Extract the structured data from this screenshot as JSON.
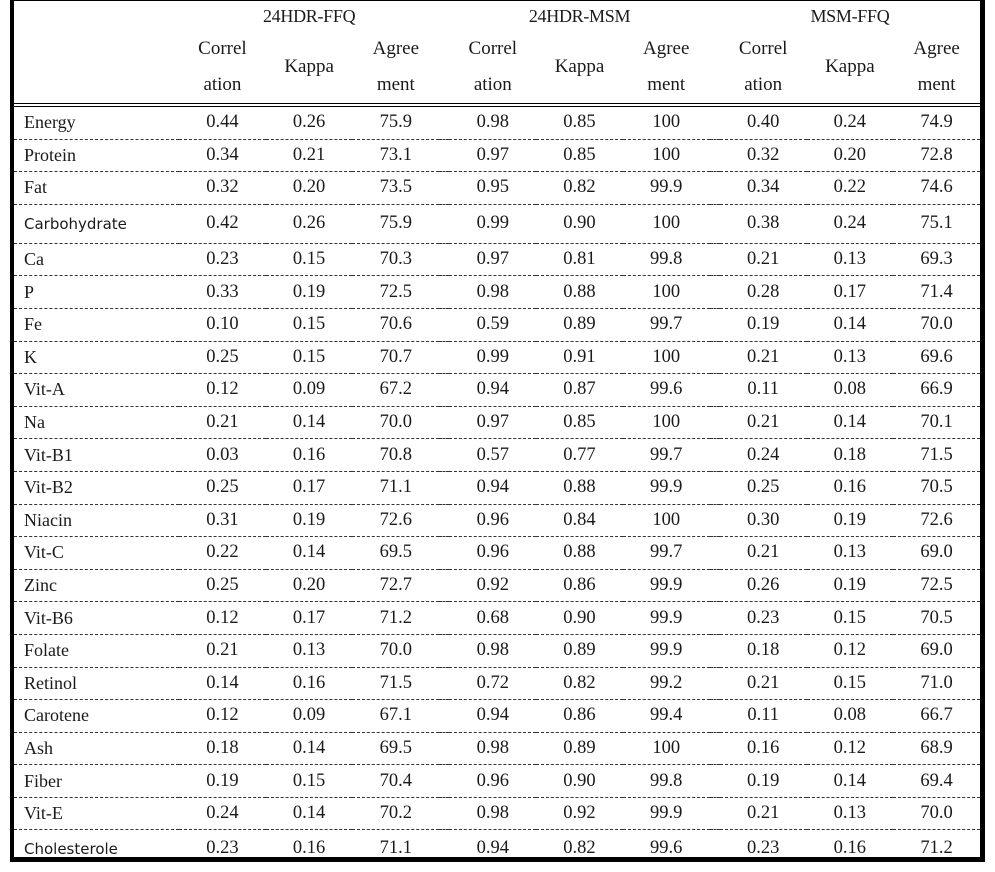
{
  "table": {
    "groups": [
      "24HDR-FFQ",
      "24HDR-MSM",
      "MSM-FFQ"
    ],
    "subheaders": {
      "correlation": [
        "Correl",
        "ation"
      ],
      "kappa": "Kappa",
      "agreement": [
        "Agree",
        "ment"
      ]
    },
    "rows": [
      {
        "label": "Energy",
        "values": [
          "0.44",
          "0.26",
          "75.9",
          "0.98",
          "0.85",
          "100",
          "0.40",
          "0.24",
          "74.9"
        ]
      },
      {
        "label": "Protein",
        "values": [
          "0.34",
          "0.21",
          "73.1",
          "0.97",
          "0.85",
          "100",
          "0.32",
          "0.20",
          "72.8"
        ]
      },
      {
        "label": "Fat",
        "values": [
          "0.32",
          "0.20",
          "73.5",
          "0.95",
          "0.82",
          "99.9",
          "0.34",
          "0.22",
          "74.6"
        ]
      },
      {
        "label": "Carbohydrate",
        "values": [
          "0.42",
          "0.26",
          "75.9",
          "0.99",
          "0.90",
          "100",
          "0.38",
          "0.24",
          "75.1"
        ]
      },
      {
        "label": "Ca",
        "values": [
          "0.23",
          "0.15",
          "70.3",
          "0.97",
          "0.81",
          "99.8",
          "0.21",
          "0.13",
          "69.3"
        ]
      },
      {
        "label": "P",
        "values": [
          "0.33",
          "0.19",
          "72.5",
          "0.98",
          "0.88",
          "100",
          "0.28",
          "0.17",
          "71.4"
        ]
      },
      {
        "label": "Fe",
        "values": [
          "0.10",
          "0.15",
          "70.6",
          "0.59",
          "0.89",
          "99.7",
          "0.19",
          "0.14",
          "70.0"
        ]
      },
      {
        "label": "K",
        "values": [
          "0.25",
          "0.15",
          "70.7",
          "0.99",
          "0.91",
          "100",
          "0.21",
          "0.13",
          "69.6"
        ]
      },
      {
        "label": "Vit-A",
        "values": [
          "0.12",
          "0.09",
          "67.2",
          "0.94",
          "0.87",
          "99.6",
          "0.11",
          "0.08",
          "66.9"
        ]
      },
      {
        "label": "Na",
        "values": [
          "0.21",
          "0.14",
          "70.0",
          "0.97",
          "0.85",
          "100",
          "0.21",
          "0.14",
          "70.1"
        ]
      },
      {
        "label": "Vit-B1",
        "values": [
          "0.03",
          "0.16",
          "70.8",
          "0.57",
          "0.77",
          "99.7",
          "0.24",
          "0.18",
          "71.5"
        ]
      },
      {
        "label": "Vit-B2",
        "values": [
          "0.25",
          "0.17",
          "71.1",
          "0.94",
          "0.88",
          "99.9",
          "0.25",
          "0.16",
          "70.5"
        ]
      },
      {
        "label": "Niacin",
        "values": [
          "0.31",
          "0.19",
          "72.6",
          "0.96",
          "0.84",
          "100",
          "0.30",
          "0.19",
          "72.6"
        ]
      },
      {
        "label": "Vit-C",
        "values": [
          "0.22",
          "0.14",
          "69.5",
          "0.96",
          "0.88",
          "99.7",
          "0.21",
          "0.13",
          "69.0"
        ]
      },
      {
        "label": "Zinc",
        "values": [
          "0.25",
          "0.20",
          "72.7",
          "0.92",
          "0.86",
          "99.9",
          "0.26",
          "0.19",
          "72.5"
        ]
      },
      {
        "label": "Vit-B6",
        "values": [
          "0.12",
          "0.17",
          "71.2",
          "0.68",
          "0.90",
          "99.9",
          "0.23",
          "0.15",
          "70.5"
        ]
      },
      {
        "label": "Folate",
        "values": [
          "0.21",
          "0.13",
          "70.0",
          "0.98",
          "0.89",
          "99.9",
          "0.18",
          "0.12",
          "69.0"
        ]
      },
      {
        "label": "Retinol",
        "values": [
          "0.14",
          "0.16",
          "71.5",
          "0.72",
          "0.82",
          "99.2",
          "0.21",
          "0.15",
          "71.0"
        ]
      },
      {
        "label": "Carotene",
        "values": [
          "0.12",
          "0.09",
          "67.1",
          "0.94",
          "0.86",
          "99.4",
          "0.11",
          "0.08",
          "66.7"
        ]
      },
      {
        "label": "Ash",
        "values": [
          "0.18",
          "0.14",
          "69.5",
          "0.98",
          "0.89",
          "100",
          "0.16",
          "0.12",
          "68.9"
        ]
      },
      {
        "label": "Fiber",
        "values": [
          "0.19",
          "0.15",
          "70.4",
          "0.96",
          "0.90",
          "99.8",
          "0.19",
          "0.14",
          "69.4"
        ]
      },
      {
        "label": "Vit-E",
        "values": [
          "0.24",
          "0.14",
          "70.2",
          "0.98",
          "0.92",
          "99.9",
          "0.21",
          "0.13",
          "70.0"
        ]
      },
      {
        "label": "Cholesterole",
        "values": [
          "0.23",
          "0.16",
          "71.1",
          "0.94",
          "0.82",
          "99.6",
          "0.23",
          "0.16",
          "71.2"
        ]
      }
    ]
  }
}
